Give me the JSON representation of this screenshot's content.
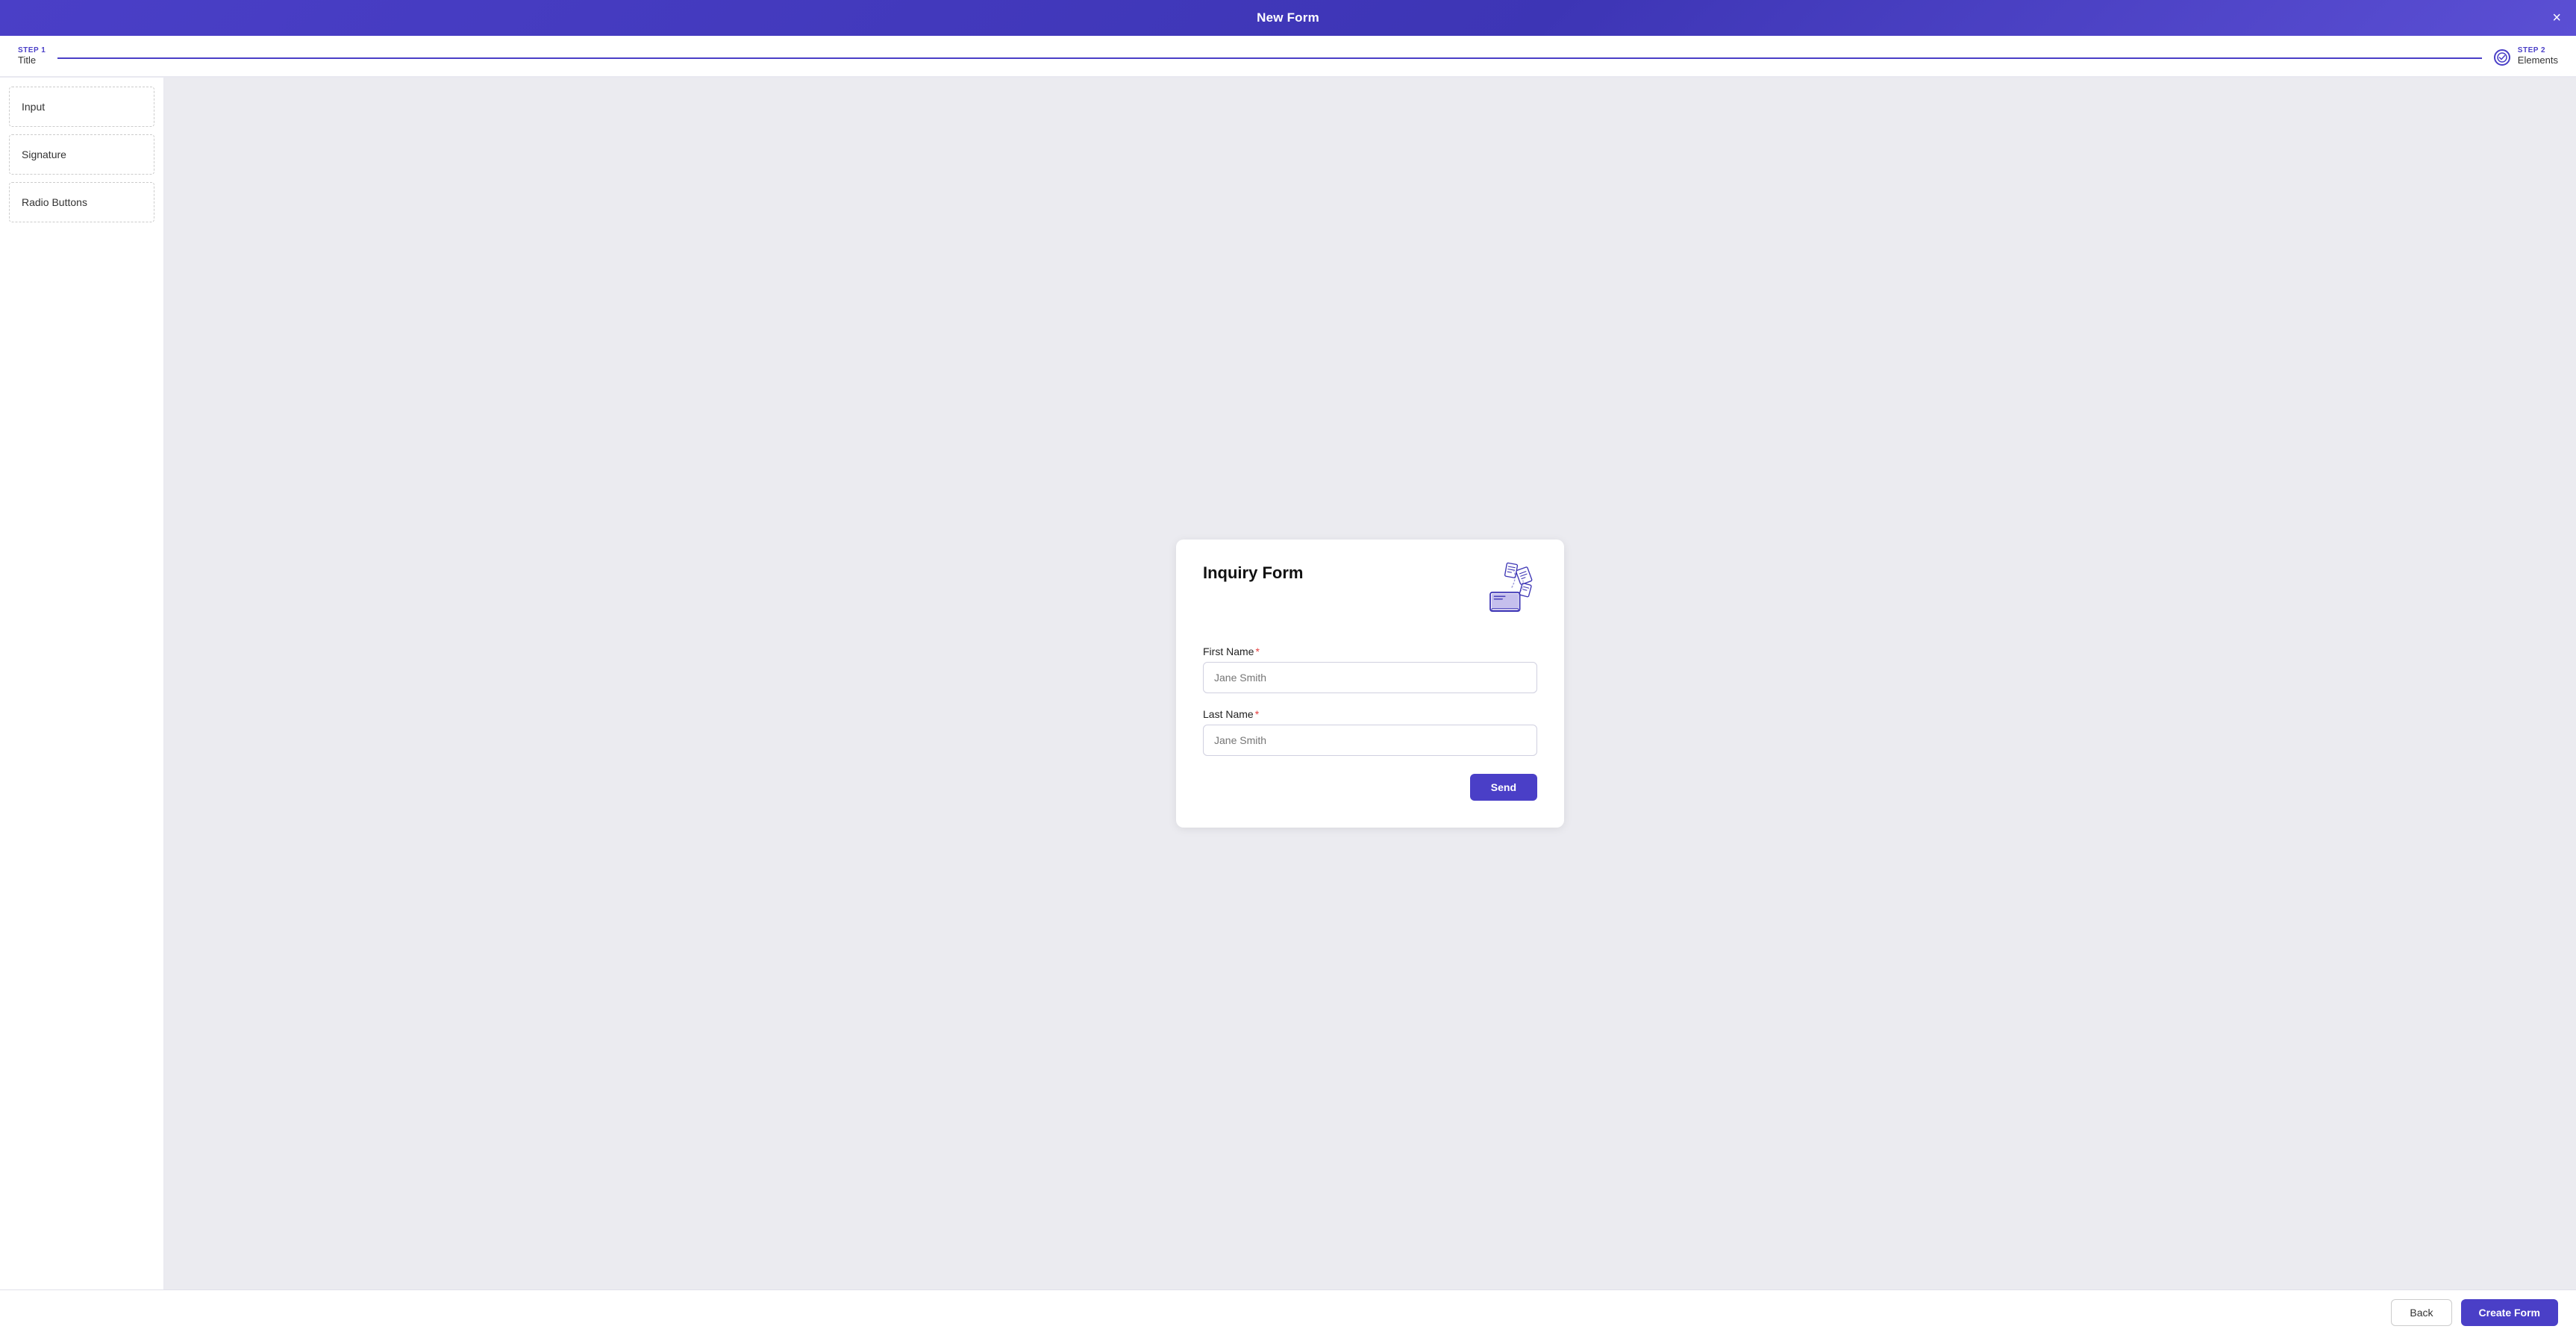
{
  "header": {
    "title": "New Form",
    "close_icon": "×"
  },
  "steps": {
    "step1": {
      "label": "STEP 1",
      "name": "Title"
    },
    "step2": {
      "label": "STEP 2",
      "name": "Elements"
    }
  },
  "sidebar": {
    "items": [
      {
        "id": "input",
        "label": "Input"
      },
      {
        "id": "signature",
        "label": "Signature"
      },
      {
        "id": "radio-buttons",
        "label": "Radio Buttons"
      }
    ]
  },
  "form_card": {
    "title": "Inquiry Form",
    "fields": [
      {
        "id": "first-name",
        "label": "First Name",
        "required": true,
        "placeholder": "Jane Smith"
      },
      {
        "id": "last-name",
        "label": "Last Name",
        "required": true,
        "placeholder": "Jane Smith"
      }
    ],
    "send_button": "Send"
  },
  "footer": {
    "back_button": "Back",
    "create_button": "Create Form"
  }
}
